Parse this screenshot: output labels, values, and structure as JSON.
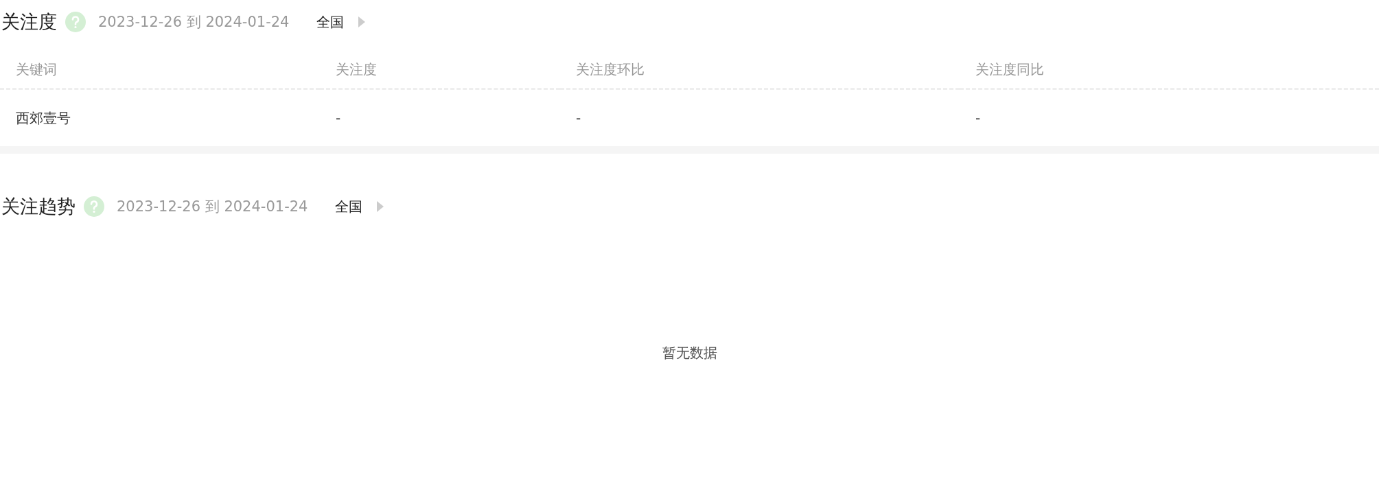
{
  "attention": {
    "title": "关注度",
    "date_range": "2023-12-26 到 2024-01-24",
    "region": "全国",
    "table": {
      "columns": [
        "关键词",
        "关注度",
        "关注度环比",
        "关注度同比"
      ],
      "rows": [
        [
          "西郊壹号",
          "-",
          "-",
          "-"
        ]
      ]
    }
  },
  "trend": {
    "title": "关注趋势",
    "date_range": "2023-12-26 到 2024-01-24",
    "region": "全国",
    "empty_text": "暂无数据"
  }
}
